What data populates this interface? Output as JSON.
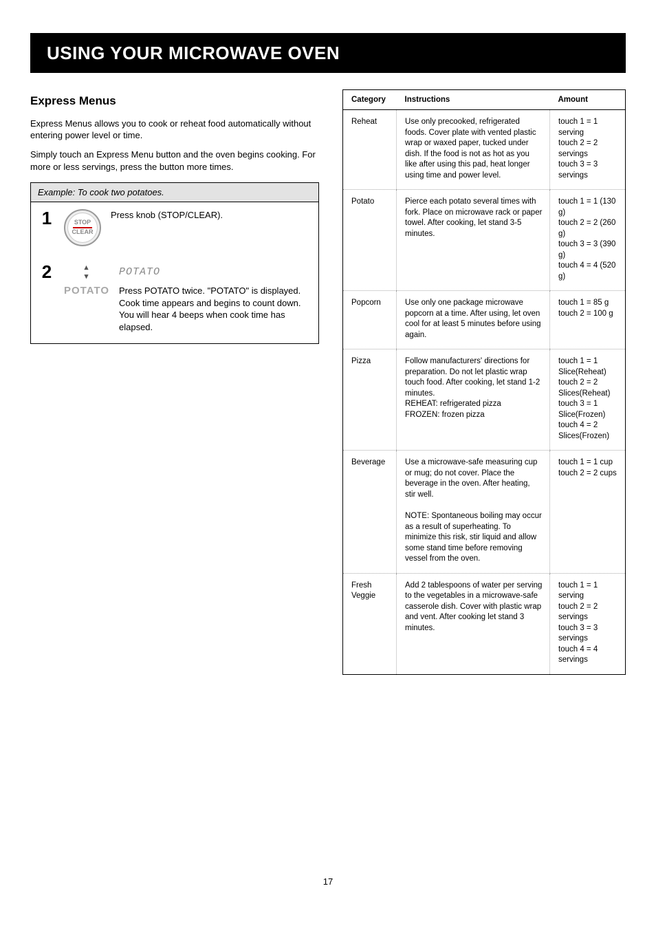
{
  "header": {
    "title": "USING YOUR MICROWAVE OVEN"
  },
  "intro": {
    "heading": "Express Menus",
    "p1": "Express Menus allows you to cook or reheat food automatically without entering power level or time.",
    "p2": "Simply touch an Express Menu button and the oven begins cooking. For more or less servings, press the button more times."
  },
  "stepsbox": {
    "head": "Example: To cook two potatoes.",
    "step1": {
      "knob_top": "STOP",
      "knob_bot": "CLEAR",
      "text": "Press knob (STOP/CLEAR)."
    },
    "step2": {
      "btn_label": "POTATO",
      "display": "POTATO",
      "text": "Press POTATO twice. \"POTATO\" is displayed. Cook time appears and begins to count down. You will hear 4 beeps when cook time has elapsed."
    }
  },
  "table": {
    "headers": [
      "Category",
      "Instructions",
      "Amount"
    ],
    "rows": [
      {
        "cat": "Reheat",
        "instr": "Use only precooked, refrigerated foods. Cover plate with vented plastic wrap or waxed paper, tucked under dish. If the food is not as hot as you like after using this pad, heat longer using time and power level.",
        "amt": "touch 1 = 1 serving\ntouch 2 = 2 servings\ntouch 3 = 3 servings"
      },
      {
        "cat": "Potato",
        "instr": "Pierce each potato several times with fork. Place on microwave rack or paper towel. After cooking, let stand 3-5 minutes.",
        "amt": "touch 1 = 1 (130 g)\ntouch 2 = 2 (260 g)\ntouch 3 = 3 (390 g)\ntouch 4 = 4 (520 g)"
      },
      {
        "cat": "Popcorn",
        "instr": "Use only one package microwave popcorn at a time. After using, let oven cool for at least 5 minutes before using again.",
        "amt": "touch 1 = 85 g\ntouch 2 = 100 g"
      },
      {
        "cat": "Pizza",
        "instr": "Follow manufacturers' directions for preparation. Do not let plastic wrap touch food. After cooking, let stand 1-2 minutes.\nREHEAT: refrigerated pizza\nFROZEN: frozen pizza",
        "amt": "touch 1 = 1 Slice(Reheat)\ntouch 2 = 2 Slices(Reheat)\ntouch 3 = 1 Slice(Frozen)\ntouch 4 = 2 Slices(Frozen)"
      },
      {
        "cat": "Beverage",
        "instr": "Use a microwave-safe measuring cup or mug; do not cover. Place the beverage in the oven. After heating, stir well.\n\nNOTE: Spontaneous boiling may occur as a result of superheating. To minimize this risk, stir liquid and allow some stand time before removing vessel from the oven.",
        "amt": "touch 1 = 1 cup\ntouch 2 = 2 cups"
      },
      {
        "cat": "Fresh\nVeggie",
        "instr": "Add 2 tablespoons of water per serving to the vegetables in a microwave-safe casserole dish. Cover with plastic wrap and vent. After cooking let stand 3 minutes.",
        "amt": "touch 1 = 1 serving\ntouch 2 = 2 servings\ntouch 3 = 3 servings\ntouch 4 = 4 servings"
      }
    ]
  },
  "page_number": "17"
}
